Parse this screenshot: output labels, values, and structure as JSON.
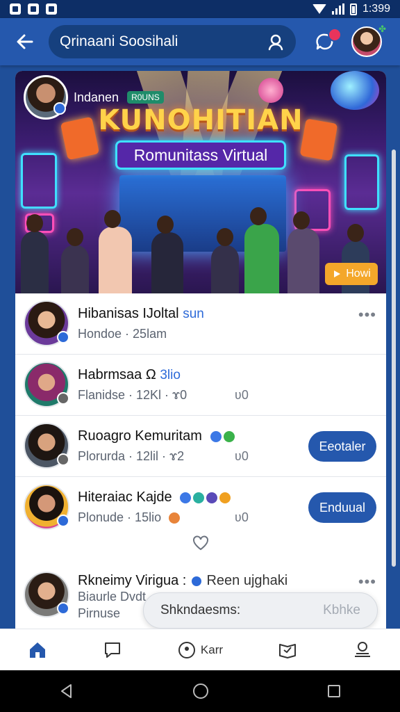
{
  "status_bar": {
    "time": "1:399"
  },
  "app_bar": {
    "search_text": "Qrinaani Soosihali"
  },
  "banner": {
    "owner_name": "Indanen",
    "owner_tag": "R0UNS",
    "title": "KUNOHITIAN",
    "subtitle": "Romunitass Virtual",
    "button_label": "Howi"
  },
  "list": [
    {
      "name": "Hibanisas IJoltal",
      "extra": "sun",
      "meta": "Hondoe · 25lam",
      "count": "",
      "action": "",
      "more": true
    },
    {
      "name": "Habrmsaa Ω",
      "extra": "3lio",
      "meta": "Flanidse · 12Kl · ɤ0",
      "count": "ʋ0",
      "action": "",
      "more": false
    },
    {
      "name": "Ruoagro Kemuritam",
      "extra": "",
      "meta": "Plorurda · 12lil · ɤ2",
      "count": "ʋ0",
      "action": "Eeotaler",
      "more": false
    },
    {
      "name": "Hiteraiac Kajde",
      "extra": "",
      "meta": "Plonude · 15lio",
      "count": "ʋ0",
      "action": "Enduual",
      "more": false
    },
    {
      "name": "Rkneimy Virigua :",
      "extra": "Reen ujghaki",
      "meta": "Biaurle Dvdt",
      "meta2": "Pirnuse",
      "count": "",
      "action": "",
      "more": true
    }
  ],
  "composer": {
    "text": "Shkndaesms:",
    "hint": "Kbhke"
  },
  "bottom_nav": {
    "profile_label": "Karr"
  },
  "colors": {
    "primary": "#2558ad",
    "dark": "#0d2e66",
    "accent": "#f4a72a"
  }
}
